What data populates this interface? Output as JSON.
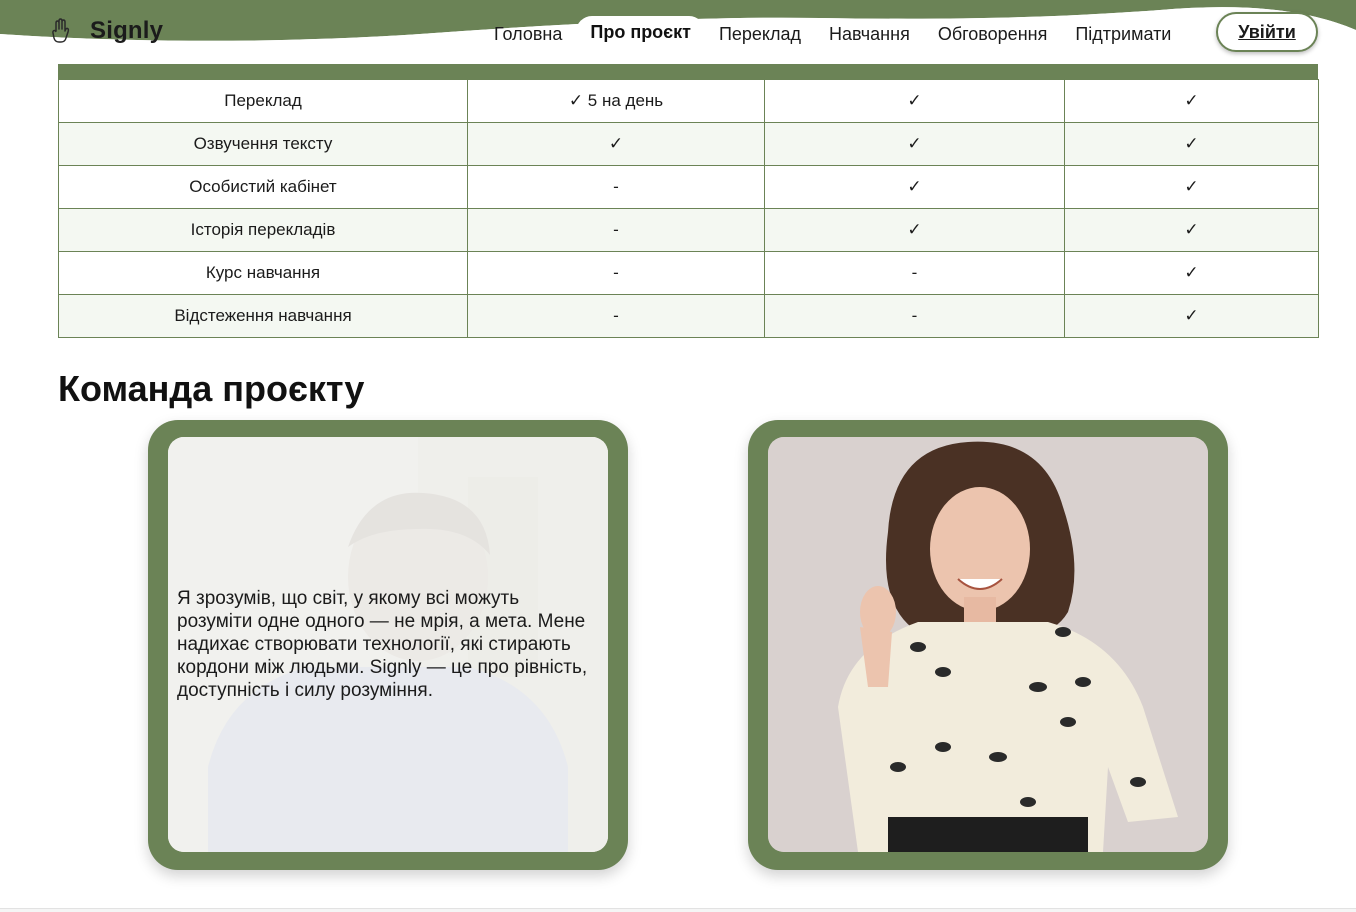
{
  "brand": {
    "name": "Signly",
    "icon": "hand-icon"
  },
  "nav": {
    "items": [
      {
        "label": "Головна"
      },
      {
        "label": "Про проєкт",
        "active": true
      },
      {
        "label": "Переклад"
      },
      {
        "label": "Навчання"
      },
      {
        "label": "Обговорення"
      },
      {
        "label": "Підтримати"
      }
    ],
    "login_label": "Увійти"
  },
  "colors": {
    "accent": "#6b8356",
    "row_alt": "#f4f8f2"
  },
  "comparison_table": {
    "rows": [
      {
        "feature": "Переклад",
        "col1": "✓ 5 на день",
        "col2": "✓",
        "col3": "✓"
      },
      {
        "feature": "Озвучення тексту",
        "col1": "✓",
        "col2": "✓",
        "col3": "✓"
      },
      {
        "feature": "Особистий кабінет",
        "col1": "-",
        "col2": "✓",
        "col3": "✓"
      },
      {
        "feature": "Історія перекладів",
        "col1": "-",
        "col2": "✓",
        "col3": "✓"
      },
      {
        "feature": "Курс навчання",
        "col1": "-",
        "col2": "-",
        "col3": "✓"
      },
      {
        "feature": "Відстеження навчання",
        "col1": "-",
        "col2": "-",
        "col3": "✓"
      }
    ]
  },
  "team": {
    "title": "Команда проєкту",
    "members": [
      {
        "quote": "Я зрозумів, що світ, у якому всі можуть розуміти одне одного — не мрія, а мета. Мене надихає створювати технології, які стирають кордони між людьми. Signly — це про рівність, доступність і силу розуміння."
      },
      {}
    ]
  }
}
